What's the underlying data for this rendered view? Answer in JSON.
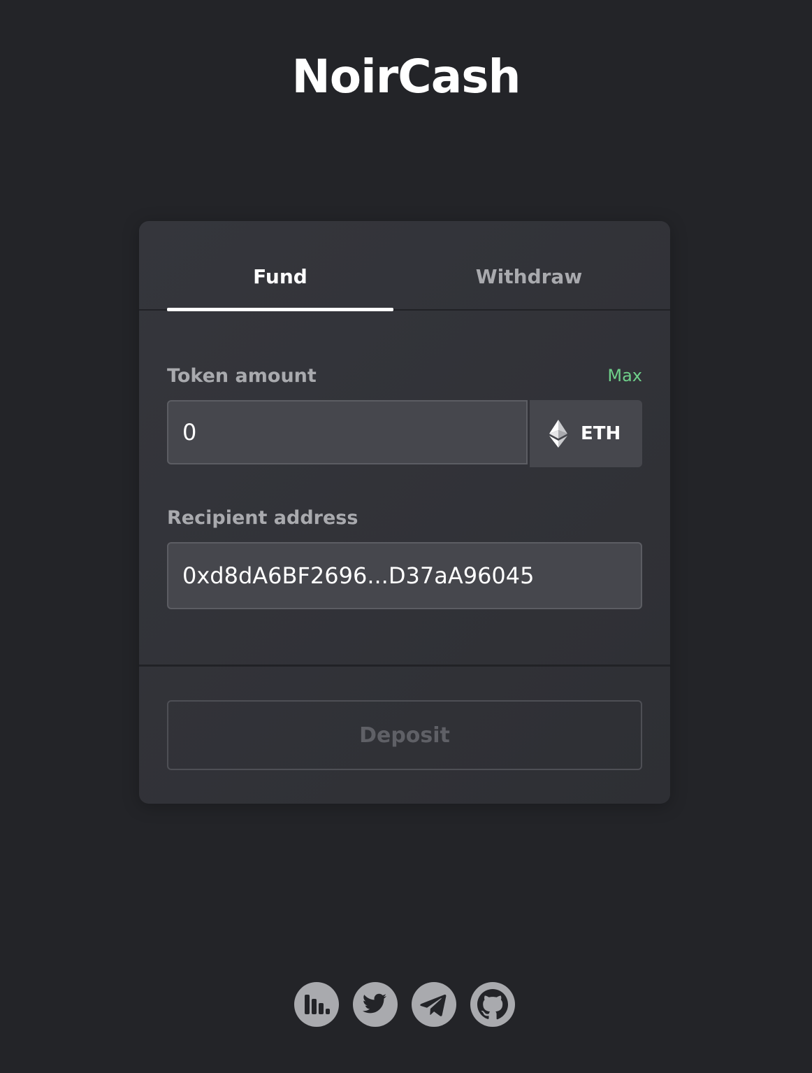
{
  "header": {
    "title": "NoirCash"
  },
  "tabs": [
    {
      "label": "Fund",
      "active": true
    },
    {
      "label": "Withdraw",
      "active": false
    }
  ],
  "form": {
    "amount_label": "Token amount",
    "max_label": "Max",
    "amount_value": "0",
    "token": {
      "symbol": "ETH",
      "icon": "ethereum-icon"
    },
    "recipient_label": "Recipient address",
    "recipient_value": "0xd8dA6BF2696...D37aA96045"
  },
  "actions": {
    "deposit_label": "Deposit",
    "deposit_disabled": true
  },
  "footer": {
    "links": [
      {
        "icon": "stats-icon"
      },
      {
        "icon": "twitter-icon"
      },
      {
        "icon": "telegram-icon"
      },
      {
        "icon": "github-icon"
      }
    ]
  },
  "colors": {
    "background": "#232428",
    "card": "#35363c",
    "accent_green": "#6fcf8a",
    "muted_text": "#a9aaae"
  }
}
